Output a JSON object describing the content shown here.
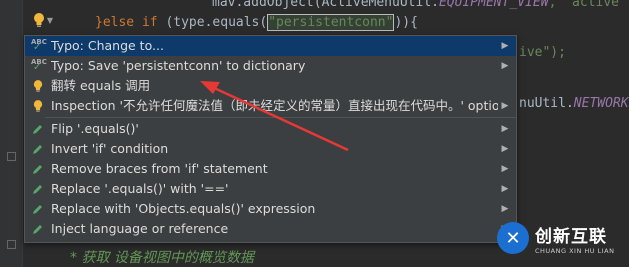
{
  "editor": {
    "line1": {
      "prefix": "mav.addObject(ActiveMenuUtil.",
      "const": "EQUIPMENT_VIEW",
      "suffix": ", \"active\");"
    },
    "line2": {
      "kw_else": "}else if",
      "text1": " (type.equals(",
      "str": "\"persistentconn\"",
      "text2": ")){"
    },
    "line3_tail": "ive\");",
    "line4_tail": "nuUtil.",
    "line4_const": "NETWORK",
    "comment": "* 获取 设备视图中的概览数据"
  },
  "popup": {
    "items": [
      {
        "label": "Typo: Change to...",
        "icon": "spellcheck-icon",
        "submenu": true,
        "selected": true
      },
      {
        "label": "Typo: Save 'persistentconn' to dictionary",
        "icon": "spellcheck-icon",
        "submenu": true
      },
      {
        "label": "翻转 equals 调用",
        "icon": "lightbulb-icon",
        "submenu": false
      },
      {
        "label": "Inspection '不允许任何魔法值（即未经定义的常量）直接出现在代码中。' options",
        "icon": "lightbulb-icon",
        "submenu": true
      },
      {
        "label": "Flip '.equals()'",
        "icon": "pencil-icon",
        "submenu": true
      },
      {
        "label": "Invert 'if' condition",
        "icon": "pencil-icon",
        "submenu": true
      },
      {
        "label": "Remove braces from 'if' statement",
        "icon": "pencil-icon",
        "submenu": true
      },
      {
        "label": "Replace '.equals()' with '=='",
        "icon": "pencil-icon",
        "submenu": true
      },
      {
        "label": "Replace with 'Objects.equals()' expression",
        "icon": "pencil-icon",
        "submenu": true
      },
      {
        "label": "Inject language or reference",
        "icon": "pencil-icon",
        "submenu": true
      }
    ]
  },
  "watermark": {
    "name": "创新互联",
    "sub": "CHUANG XIN HU LIAN"
  },
  "colors": {
    "selection": "#0d3a6b",
    "arrow": "#e53935",
    "bulb": "#f0b73a",
    "pencil": "#59a869"
  }
}
